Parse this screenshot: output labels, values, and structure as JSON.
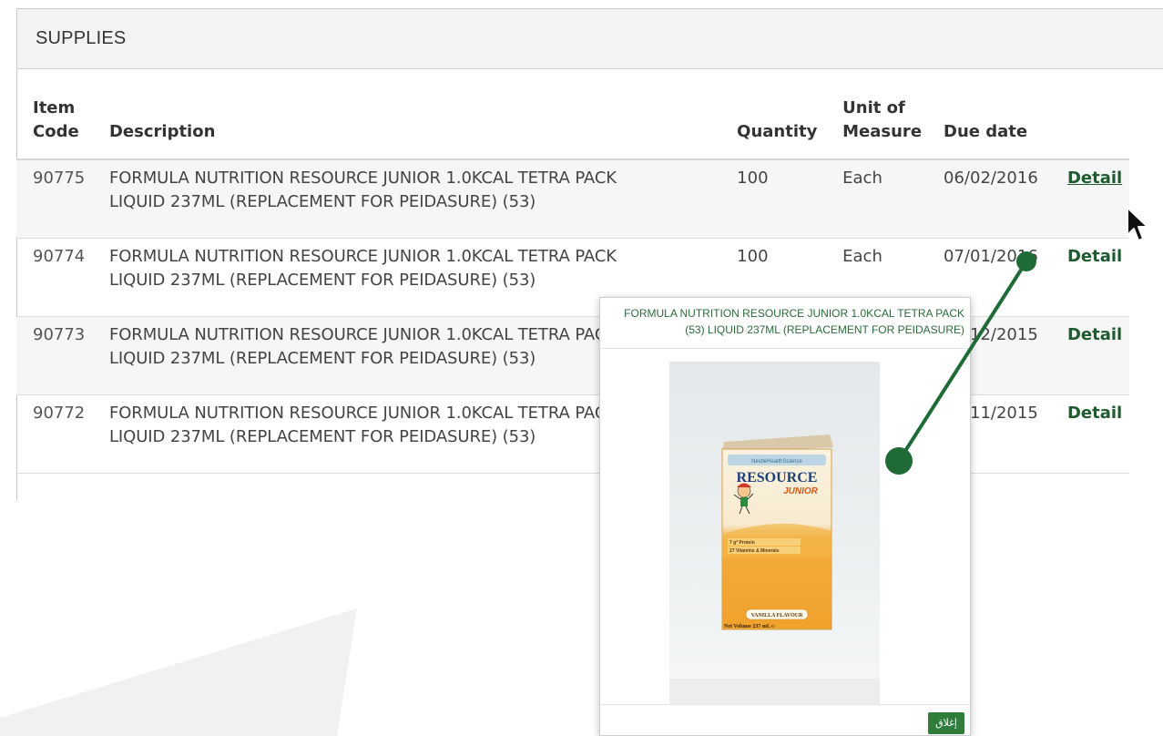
{
  "panel": {
    "title": "SUPPLIES"
  },
  "table": {
    "columns": {
      "item_code": [
        "Item",
        "Code"
      ],
      "description": "Description",
      "quantity": "Quantity",
      "unit_of_measure": [
        "Unit of",
        "Measure"
      ],
      "due_date": "Due date"
    },
    "rows": [
      {
        "code": "90775",
        "desc_line1": "FORMULA NUTRITION RESOURCE JUNIOR 1.0KCAL TETRA PACK",
        "desc_line2": "LIQUID 237ML (REPLACEMENT FOR PEIDASURE) (53)",
        "quantity": "100",
        "unit": "Each",
        "due": "06/02/2016",
        "link": "Detail"
      },
      {
        "code": "90774",
        "desc_line1": "FORMULA NUTRITION RESOURCE JUNIOR 1.0KCAL TETRA PACK",
        "desc_line2": "LIQUID 237ML (REPLACEMENT FOR PEIDASURE) (53)",
        "quantity": "100",
        "unit": "Each",
        "due": "07/01/2016",
        "link": "Detail"
      },
      {
        "code": "90773",
        "desc_line1": "FORMULA NUTRITION RESOURCE JUNIOR 1.0KCAL TETRA PACK",
        "desc_line2": "LIQUID 237ML (REPLACEMENT FOR PEIDASURE) (53)",
        "quantity": "",
        "unit": "",
        "due": "08/12/2015",
        "link": "Detail"
      },
      {
        "code": "90772",
        "desc_line1": "FORMULA NUTRITION RESOURCE JUNIOR 1.0KCAL TETRA PACK",
        "desc_line2": "LIQUID 237ML (REPLACEMENT FOR PEIDASURE) (53)",
        "quantity": "",
        "unit": "",
        "due": "08/11/2015",
        "link": "Detail"
      }
    ]
  },
  "popup": {
    "title_line1": "FORMULA NUTRITION RESOURCE JUNIOR 1.0KCAL TETRA PACK",
    "title_line2": "(53) LIQUID 237ML (REPLACEMENT FOR PEIDASURE)",
    "product": {
      "brand_top": "NestléHealthScience",
      "brand": "RESOURCE",
      "sub_brand": "JUNIOR",
      "claim1": "7 g* Protein",
      "claim2": "27 Vitamins & Minerals",
      "flavour": "VANILLA FLAVOUR",
      "volume": "Net Volume 237 mL ℮"
    },
    "close_label": "إغلاق"
  },
  "colors": {
    "link": "#1e5b2f",
    "connector": "#1f6b37",
    "close_button": "#2e7d3a",
    "carton": "#f2a62a"
  }
}
